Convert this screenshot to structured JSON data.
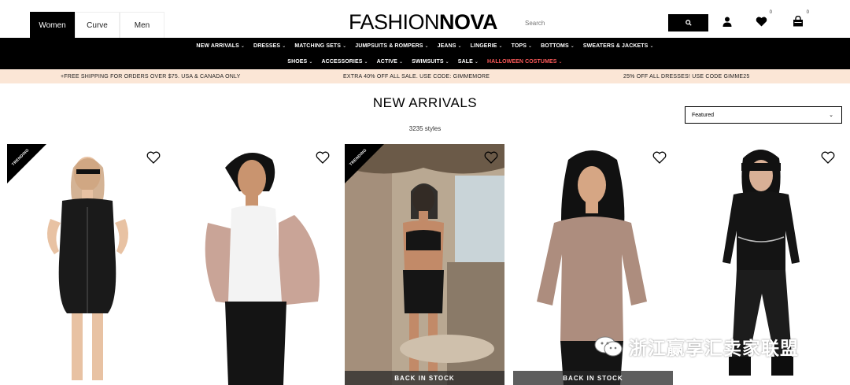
{
  "header": {
    "gender_tabs": [
      {
        "label": "Women",
        "active": true
      },
      {
        "label": "Curve",
        "active": false
      },
      {
        "label": "Men",
        "active": false
      }
    ],
    "logo_light": "FASHION",
    "logo_bold": "NOVA",
    "search_placeholder": "Search",
    "wishlist_count": "0",
    "cart_count": "0"
  },
  "nav": {
    "row1": [
      "NEW ARRIVALS",
      "DRESSES",
      "MATCHING SETS",
      "JUMPSUITS & ROMPERS",
      "JEANS",
      "LINGERIE",
      "TOPS",
      "BOTTOMS",
      "SWEATERS & JACKETS"
    ],
    "row2": [
      "SHOES",
      "ACCESSORIES",
      "ACTIVE",
      "SWIMSUITS",
      "SALE",
      "HALLOWEEN COSTUMES"
    ]
  },
  "promo": {
    "left": "+FREE SHIPPING FOR ORDERS OVER $75. USA & CANADA ONLY",
    "center": "EXTRA 40% OFF ALL SALE. USE CODE: GIMMEMORE",
    "right": "25% OFF ALL DRESSES! USE CODE GIMME25"
  },
  "listing": {
    "title": "NEW ARRIVALS",
    "count": "3235 styles",
    "sort_value": "Featured"
  },
  "products": [
    {
      "trending": true,
      "trending_label": "TRENDING",
      "back_in_stock": false,
      "skin": "#e8c2a3",
      "bg": "#ffffff",
      "outfit": "#1a1a1a"
    },
    {
      "trending": false,
      "back_in_stock": false,
      "skin": "#c9946f",
      "bg": "#ffffff",
      "outfit": "#f3f3f3"
    },
    {
      "trending": true,
      "trending_label": "TRENDING",
      "back_in_stock": true,
      "bis_label": "BACK IN STOCK",
      "skin": "#c28a68",
      "bg": "#9a8a7a",
      "outfit": "#151515"
    },
    {
      "trending": false,
      "back_in_stock": true,
      "bis_label": "BACK IN STOCK",
      "skin": "#d6a684",
      "bg": "#ffffff",
      "outfit": "#ad8d7e"
    },
    {
      "trending": false,
      "back_in_stock": false,
      "skin": "#d9b096",
      "bg": "#ffffff",
      "outfit": "#141414"
    }
  ],
  "watermark": "浙江赢享汇卖家联盟",
  "colors": {
    "accent": "#000000",
    "promo_bg": "#fbe6d6",
    "halloween": "#ff5a5a"
  }
}
